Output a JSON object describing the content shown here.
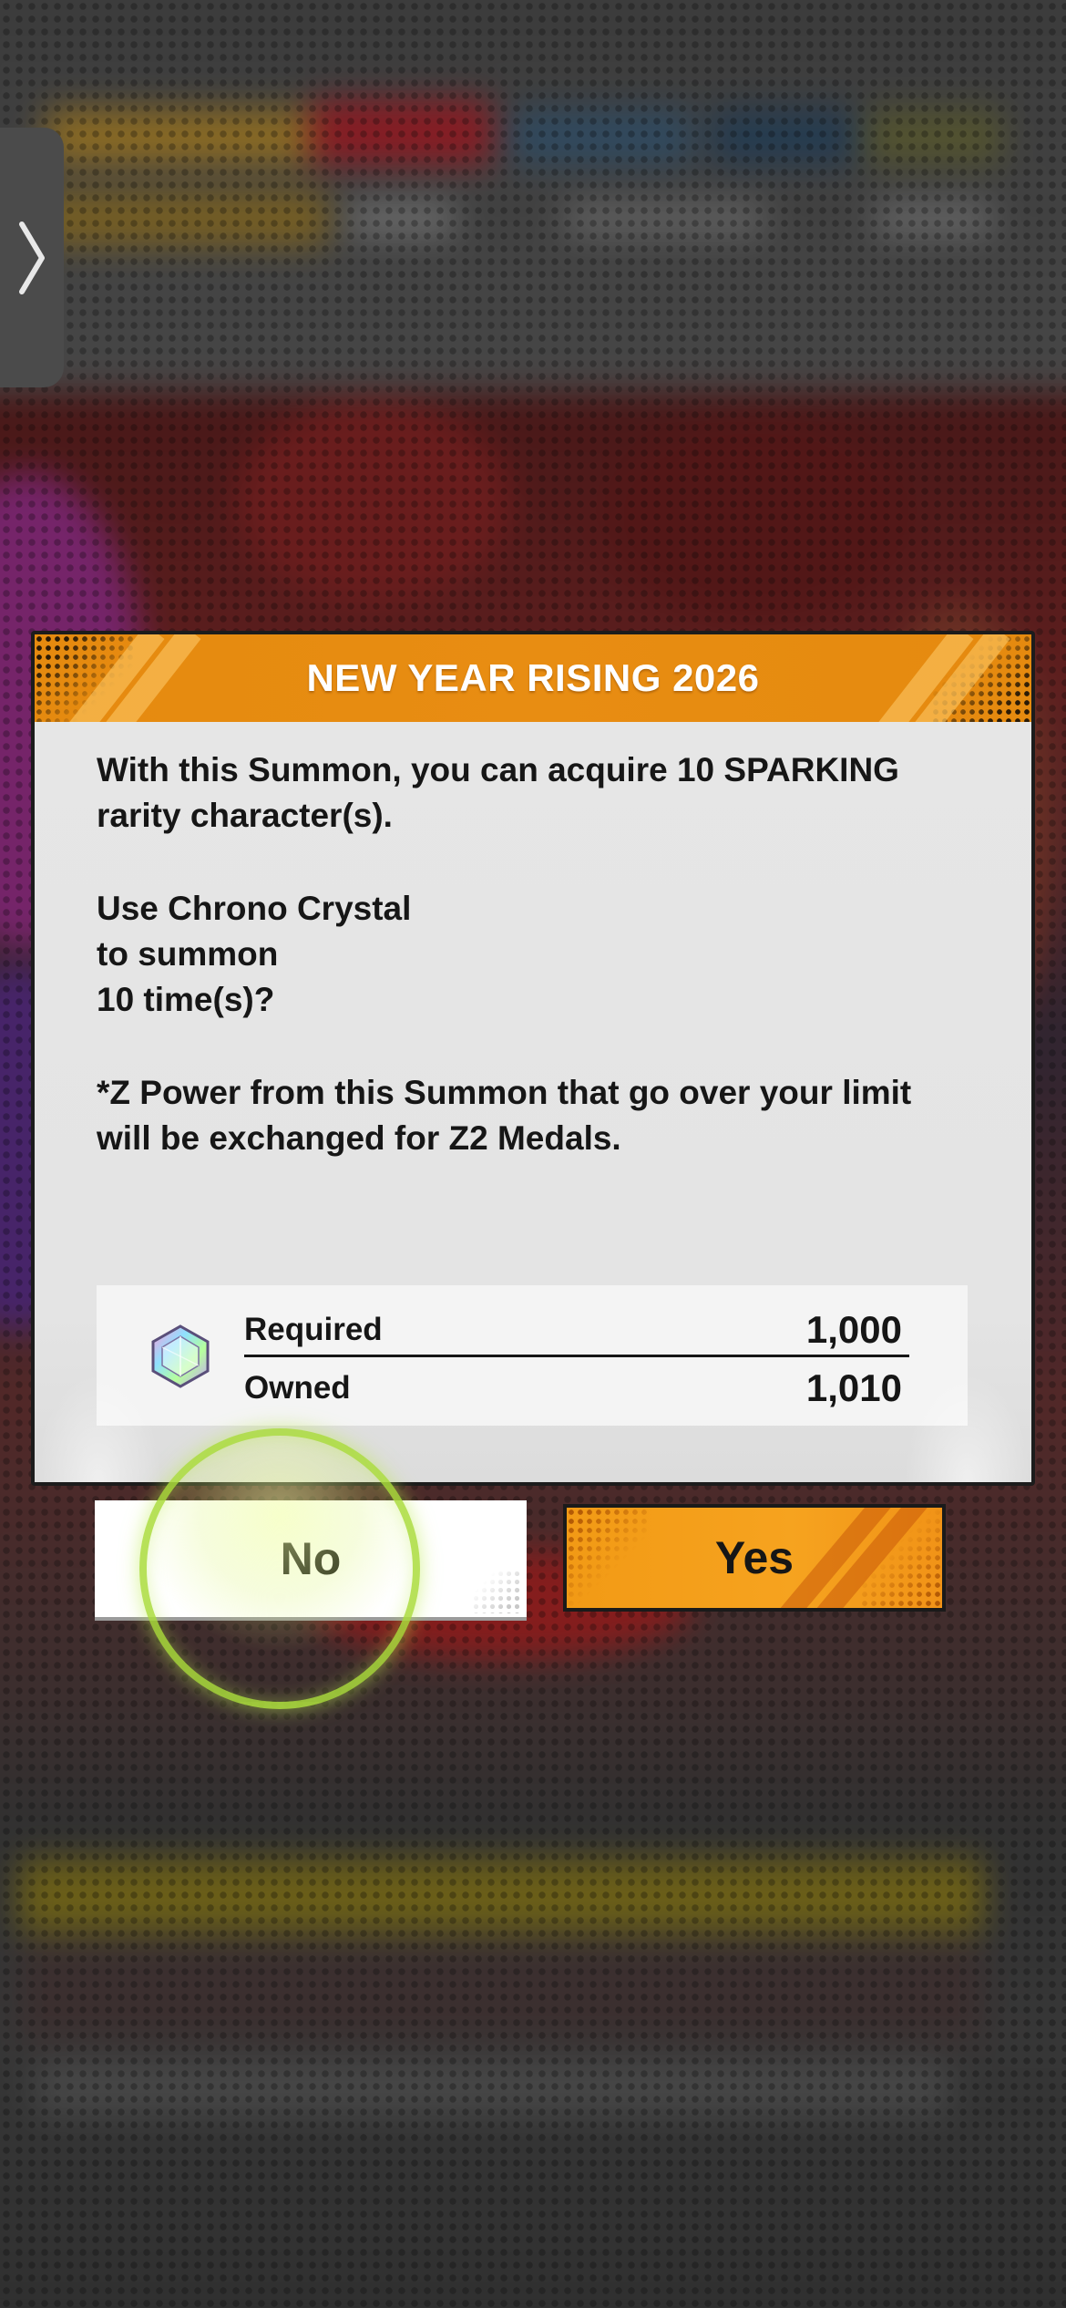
{
  "colors": {
    "header_orange": "#e88d12",
    "yes_button": "#f6a31f",
    "dialog_bg": "#e6e6e6",
    "tap_ring": "#aadc3c"
  },
  "side_tab": {
    "icon": "chevron-right-icon"
  },
  "dialog": {
    "title": "NEW YEAR RISING 2026",
    "line1": "With this Summon, you can acquire 10 SPARKING rarity character(s).",
    "line2": "Use Chrono Crystal",
    "line3": "to summon",
    "line4": "10 time(s)?",
    "note": "*Z Power from this Summon that go over your limit will be exchanged for Z2 Medals.",
    "cost": {
      "icon": "chrono-crystal-icon",
      "required_label": "Required",
      "required_value": "1,000",
      "owned_label": "Owned",
      "owned_value": "1,010"
    }
  },
  "buttons": {
    "no_label": "No",
    "yes_label": "Yes"
  }
}
